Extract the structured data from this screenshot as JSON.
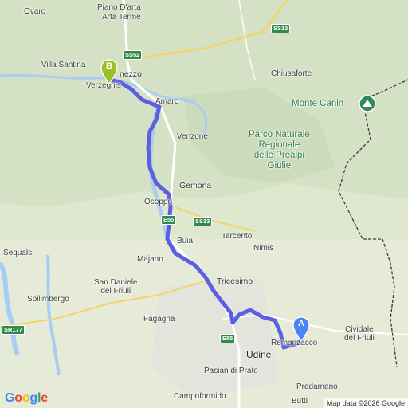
{
  "map": {
    "labels": {
      "ovaro": "Ovaro",
      "piano_darta": "Piano D'arta",
      "arta_terme": "Arta Terme",
      "villa_santina": "Villa Santina",
      "verzegnis": "Verzegnis",
      "tolmezzo": "nezzo",
      "amaro": "Amaro",
      "chiusaforte": "Chiusaforte",
      "monte_canin": "Monte Canin",
      "park": "Parco Naturale\nRegionale\ndelle Prealpi\nGiulie",
      "venzone": "Venzone",
      "gemona": "Gemona",
      "osoppo": "Osoppo",
      "buia": "Buia",
      "tarcento": "Tarcento",
      "nimis": "Nimis",
      "majano": "Majano",
      "sequals": "Sequals",
      "san_daniele": "San Daniele\ndel Friuli",
      "tricesimo": "Tricesimo",
      "spilimbergo": "Spilimbergo",
      "fagagna": "Fagagna",
      "remanzacco": "Remanzacco",
      "cividale": "Cividale\ndel Friuli",
      "udine": "Udine",
      "pasian_di_prato": "Pasian di Prato",
      "pradamano": "Pradamano",
      "campoformido": "Campoformido",
      "butti": "Butti"
    },
    "shields": {
      "ss52": "SS52",
      "ss13_north": "SS13",
      "e55_north": "E55",
      "ss13_south": "SS13",
      "sr177": "SR177",
      "e55_south": "E55"
    },
    "markers": {
      "origin": {
        "label": "A",
        "color": "#4d86f0"
      },
      "destination": {
        "label": "B",
        "color": "#9bbf27"
      }
    },
    "attribution": "Map data ©2026 Google",
    "logo": "Google",
    "colors": {
      "route": "#5b5fe0",
      "water": "#a9cdf2",
      "land": "#dfe8cf",
      "border": "#3a3a3a"
    }
  }
}
